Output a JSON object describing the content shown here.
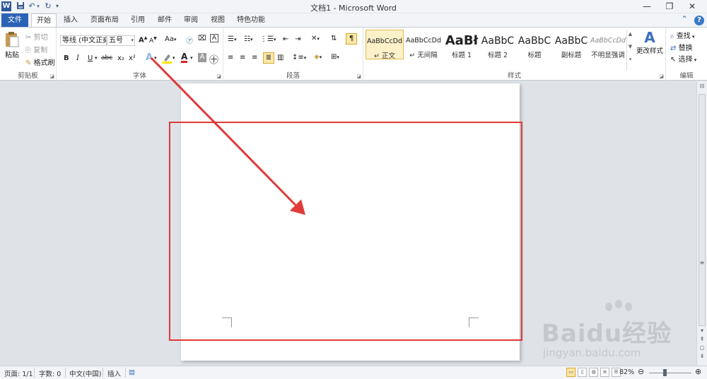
{
  "window": {
    "title": "文档1 - Microsoft Word",
    "logo": "W",
    "controls": {
      "minimize": "—",
      "restore": "❐",
      "close": "✕"
    }
  },
  "quick_access": [
    "save-icon",
    "undo-icon",
    "redo-icon",
    "customize-icon"
  ],
  "tabs": [
    "文件",
    "开始",
    "插入",
    "页面布局",
    "引用",
    "邮件",
    "审阅",
    "视图",
    "特色功能"
  ],
  "active_tab": "开始",
  "ribbon": {
    "clipboard": {
      "label": "剪贴板",
      "paste": "粘贴",
      "cut": "剪切",
      "copy": "复制",
      "format_painter": "格式刷"
    },
    "font": {
      "label": "字体",
      "font_name": "等线 (中文正文)",
      "font_size": "五号",
      "grow": "A",
      "shrink": "A",
      "change_case": "Aa",
      "bold": "B",
      "italic": "I",
      "underline": "U",
      "strikethrough": "abc",
      "subscript": "x₂",
      "superscript": "x²",
      "text_effect": "A",
      "font_color": "A"
    },
    "paragraph": {
      "label": "段落"
    },
    "styles": {
      "label": "样式",
      "items": [
        {
          "sample": "AaBbCcDd",
          "name": "正文"
        },
        {
          "sample": "AaBbCcDd",
          "name": "无间隔"
        },
        {
          "sample": "AaBł",
          "name": "标题 1"
        },
        {
          "sample": "AaBbC",
          "name": "标题 2"
        },
        {
          "sample": "AaBbC",
          "name": "标题"
        },
        {
          "sample": "AaBbC",
          "name": "副标题"
        },
        {
          "sample": "AaBbCcDd",
          "name": "不明显强调"
        }
      ],
      "change_styles": "更改样式"
    },
    "editing": {
      "label": "编辑",
      "find": "查找",
      "replace": "替换",
      "select": "选择"
    }
  },
  "watermark": {
    "brand": "Baidu经验",
    "url": "jingyan.baidu.com"
  },
  "status": {
    "page": "页面: 1/1",
    "words": "字数: 0",
    "language": "中文(中国)",
    "mode": "插入",
    "zoom": "82%"
  },
  "colors": {
    "file_tab": "#2a63b6",
    "annotation": "#e03a3a",
    "selected_style": "#fdf1c9"
  }
}
